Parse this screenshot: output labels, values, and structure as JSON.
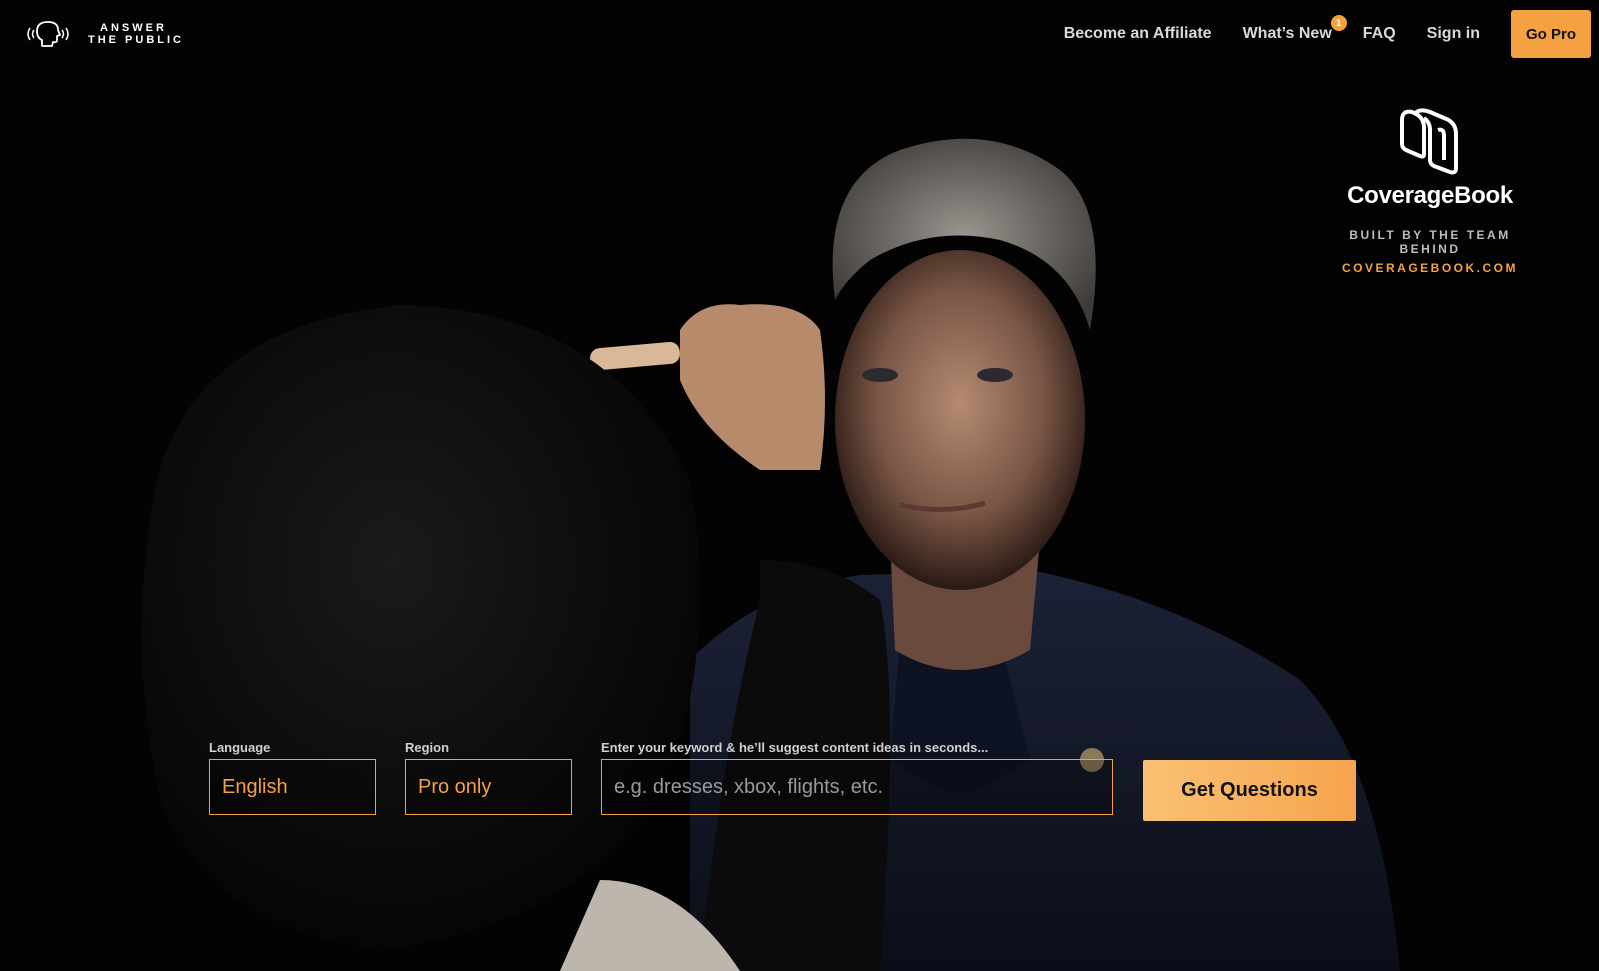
{
  "brand": {
    "line1": "ANSWER",
    "line2": "THE PUBLIC"
  },
  "nav": {
    "affiliate": "Become an Affiliate",
    "whats_new": "What’s New",
    "whats_new_badge": "1",
    "faq": "FAQ",
    "sign_in": "Sign in",
    "go_pro": "Go Pro"
  },
  "coveragebook": {
    "name": "CoverageBook",
    "built_by": "BUILT BY THE TEAM BEHIND",
    "url": "COVERAGEBOOK.COM"
  },
  "search": {
    "language_label": "Language",
    "language_value": "English",
    "region_label": "Region",
    "region_value": "Pro only",
    "keyword_label": "Enter your keyword & he’ll suggest content ideas in seconds...",
    "keyword_placeholder": "e.g. dresses, xbox, flights, etc.",
    "keyword_value": "",
    "submit_label": "Get Questions"
  },
  "colors": {
    "accent": "#f5a142",
    "background": "#000000",
    "nav_text": "#d9d9d9"
  },
  "icons": {
    "brand": "talking-head-icon",
    "coveragebook": "coveragebook-logo-icon"
  }
}
